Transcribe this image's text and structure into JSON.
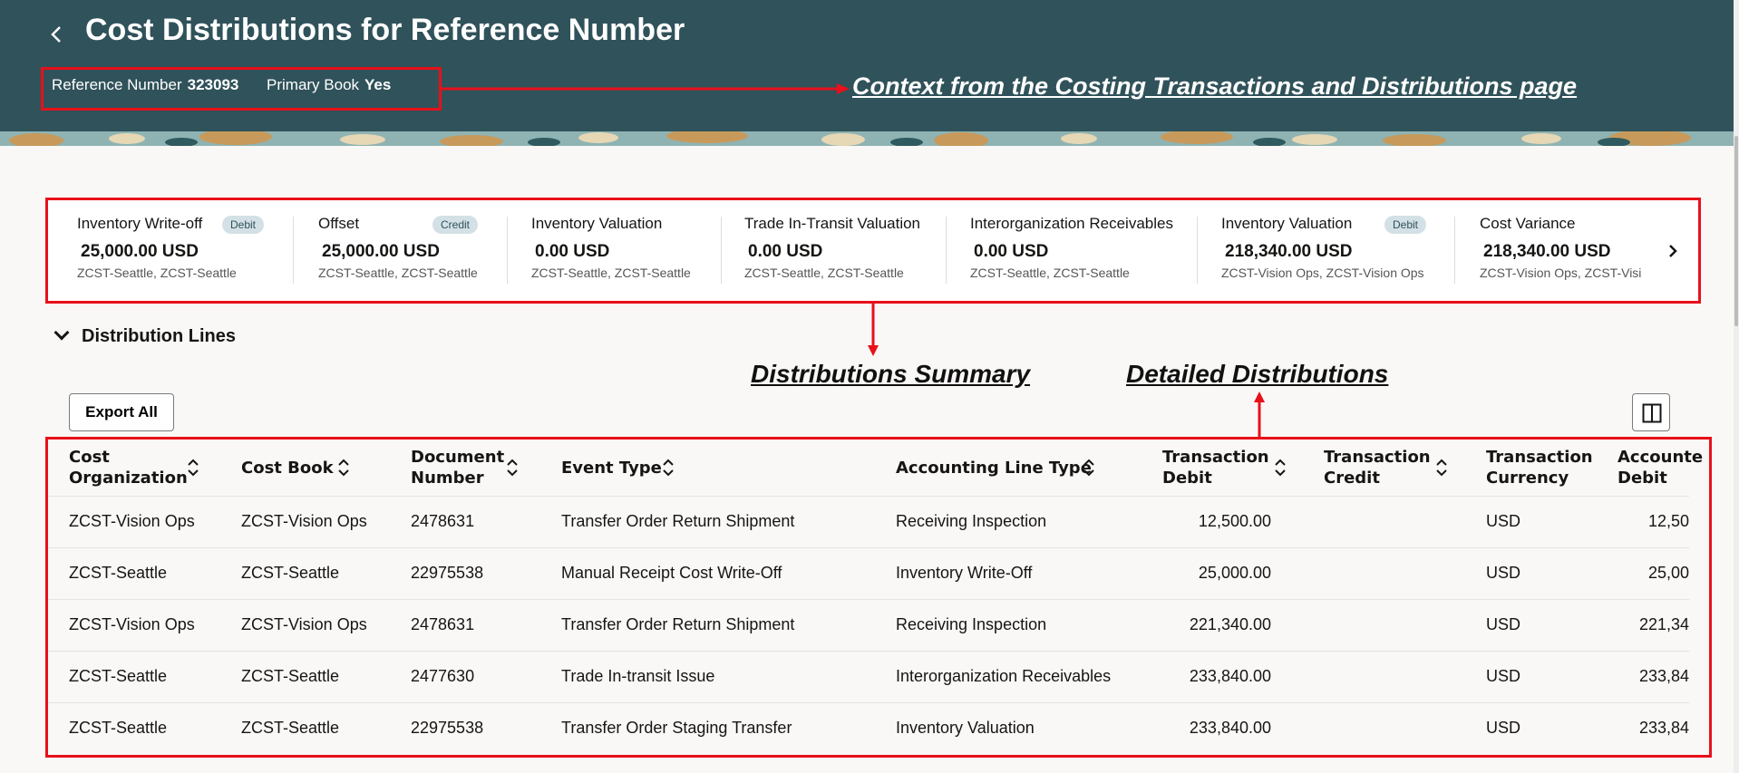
{
  "header": {
    "back_icon": "chevron-left-icon",
    "title": "Cost Distributions for Reference Number",
    "reference_label": "Reference Number",
    "reference_value": "323093",
    "primary_book_label": "Primary Book",
    "primary_book_value": "Yes",
    "bg_color": "#30525a"
  },
  "annotations": {
    "context": "Context from the Costing Transactions and Distributions page",
    "summary": "Distributions Summary",
    "detailed": "Detailed Distributions",
    "highlight_color": "#e8101a"
  },
  "summary_cards": [
    {
      "title": "Inventory Write-off",
      "badge": "Debit",
      "amount": "25,000.00 USD",
      "orgs": "ZCST-Seattle, ZCST-Seattle"
    },
    {
      "title": "Offset",
      "badge": "Credit",
      "amount": "25,000.00 USD",
      "orgs": "ZCST-Seattle, ZCST-Seattle"
    },
    {
      "title": "Inventory Valuation",
      "badge": "",
      "amount": "0.00 USD",
      "orgs": "ZCST-Seattle, ZCST-Seattle"
    },
    {
      "title": "Trade In-Transit Valuation",
      "badge": "",
      "amount": "0.00 USD",
      "orgs": "ZCST-Seattle, ZCST-Seattle"
    },
    {
      "title": "Interorganization Receivables",
      "badge": "",
      "amount": "0.00 USD",
      "orgs": "ZCST-Seattle, ZCST-Seattle"
    },
    {
      "title": "Inventory Valuation",
      "badge": "Debit",
      "amount": "218,340.00 USD",
      "orgs": "ZCST-Vision Ops, ZCST-Vision Ops"
    },
    {
      "title": "Cost Variance",
      "badge": "",
      "amount": "218,340.00 USD",
      "orgs": "ZCST-Vision Ops, ZCST-Visi"
    }
  ],
  "summary_next_icon": "chevron-right-icon",
  "section": {
    "title": "Distribution Lines",
    "toggle_icon": "chevron-down-icon"
  },
  "toolbar": {
    "export_label": "Export All",
    "columns_icon": "column-layout-icon"
  },
  "table": {
    "columns": [
      {
        "l1": "Cost",
        "l2": "Organization",
        "sortable": true
      },
      {
        "l1": "Cost Book",
        "l2": "",
        "sortable": true
      },
      {
        "l1": "Document",
        "l2": "Number",
        "sortable": true
      },
      {
        "l1": "Event Type",
        "l2": "",
        "sortable": true
      },
      {
        "l1": "Accounting Line Type",
        "l2": "",
        "sortable": true
      },
      {
        "l1": "Transaction",
        "l2": "Debit",
        "sortable": true
      },
      {
        "l1": "Transaction",
        "l2": "Credit",
        "sortable": true
      },
      {
        "l1": "Transaction",
        "l2": "Currency",
        "sortable": false
      },
      {
        "l1": "Accounte",
        "l2": "Debit",
        "sortable": false
      }
    ],
    "rows": [
      [
        "ZCST-Vision Ops",
        "ZCST-Vision Ops",
        "2478631",
        "Transfer Order Return Shipment",
        "Receiving Inspection",
        "12,500.00",
        "",
        "USD",
        "12,50"
      ],
      [
        "ZCST-Seattle",
        "ZCST-Seattle",
        "22975538",
        "Manual Receipt Cost Write-Off",
        "Inventory Write-Off",
        "25,000.00",
        "",
        "USD",
        "25,00"
      ],
      [
        "ZCST-Vision Ops",
        "ZCST-Vision Ops",
        "2478631",
        "Transfer Order Return Shipment",
        "Receiving Inspection",
        "221,340.00",
        "",
        "USD",
        "221,34"
      ],
      [
        "ZCST-Seattle",
        "ZCST-Seattle",
        "2477630",
        "Trade In-transit Issue",
        "Interorganization Receivables",
        "233,840.00",
        "",
        "USD",
        "233,84"
      ],
      [
        "ZCST-Seattle",
        "ZCST-Seattle",
        "22975538",
        "Transfer Order Staging Transfer",
        "Inventory Valuation",
        "233,840.00",
        "",
        "USD",
        "233,84"
      ]
    ]
  }
}
